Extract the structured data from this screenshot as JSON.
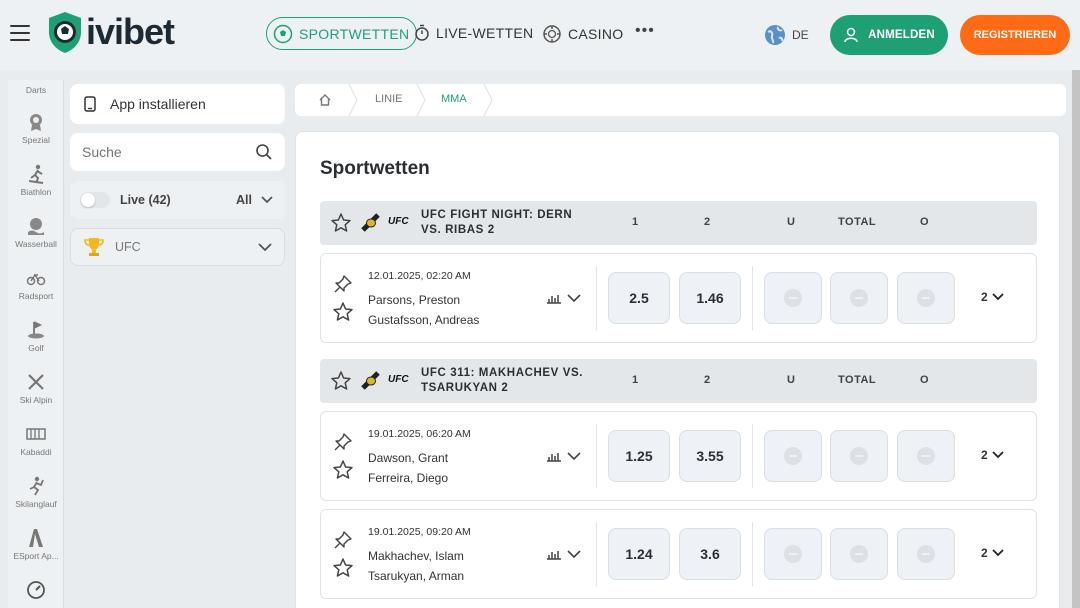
{
  "header": {
    "logo_text": "ivibet",
    "nav": [
      {
        "label": "SPORTWETTEN",
        "icon": "soccer-ball-icon",
        "active": true
      },
      {
        "label": "LIVE-WETTEN",
        "icon": "stopwatch-icon"
      },
      {
        "label": "CASINO",
        "icon": "casino-chip-icon"
      }
    ],
    "more_label": "•••",
    "lang": "DE",
    "login_label": "ANMELDEN",
    "register_label": "REGISTRIEREN",
    "colors": {
      "accent": "#1e9f74",
      "orange": "#ff6a14"
    }
  },
  "sport_rail": [
    {
      "label": "Darts",
      "icon": "darts-icon"
    },
    {
      "label": "Spezial",
      "icon": "medal-icon"
    },
    {
      "label": "Biathlon",
      "icon": "biathlon-icon"
    },
    {
      "label": "Wasserball",
      "icon": "water-polo-icon"
    },
    {
      "label": "Radsport",
      "icon": "bicycle-icon"
    },
    {
      "label": "Golf",
      "icon": "golf-icon"
    },
    {
      "label": "Ski Alpin",
      "icon": "ski-icon"
    },
    {
      "label": "Kabaddi",
      "icon": "kabaddi-icon"
    },
    {
      "label": "Skilanglauf",
      "icon": "cross-country-ski-icon"
    },
    {
      "label": "ESport Ap...",
      "icon": "esport-icon"
    }
  ],
  "left_panel": {
    "app_install": "App installieren",
    "search_placeholder": "Suche",
    "live_label": "Live (42)",
    "all_label": "All",
    "league_label": "UFC"
  },
  "breadcrumb": [
    "LINIE",
    "MMA"
  ],
  "main": {
    "title": "Sportwetten",
    "columns": [
      "1",
      "2",
      "U",
      "TOTAL",
      "O"
    ],
    "events": [
      {
        "name": "UFC FIGHT NIGHT: DERN VS. RIBAS 2",
        "matches": [
          {
            "date": "12.01.2025, 02:20 AM",
            "team1": "Parsons, Preston",
            "team2": "Gustafsson, Andreas",
            "odd1": "2.5",
            "odd2": "1.46",
            "more": "2"
          }
        ]
      },
      {
        "name": "UFC 311: MAKHACHEV VS. TSARUKYAN 2",
        "matches": [
          {
            "date": "19.01.2025, 06:20 AM",
            "team1": "Dawson, Grant",
            "team2": "Ferreira, Diego",
            "odd1": "1.25",
            "odd2": "3.55",
            "more": "2"
          },
          {
            "date": "19.01.2025, 09:20 AM",
            "team1": "Makhachev, Islam",
            "team2": "Tsarukyan, Arman",
            "odd1": "1.24",
            "odd2": "3.6",
            "more": "2"
          }
        ]
      }
    ]
  }
}
